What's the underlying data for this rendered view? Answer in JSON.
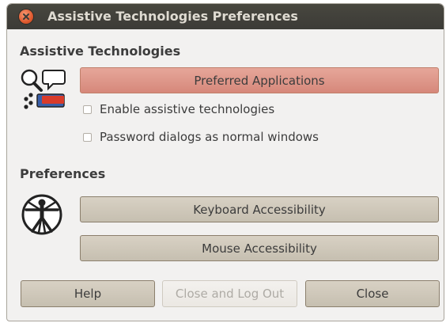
{
  "window": {
    "title": "Assistive Technologies Preferences",
    "close_icon": "close-icon"
  },
  "assistive": {
    "heading": "Assistive Technologies",
    "icon": "assistive-technologies-icon",
    "preferred_apps_label": "Preferred Applications",
    "enable_label": "Enable assistive technologies",
    "enable_checked": false,
    "password_label": "Password dialogs as normal windows",
    "password_checked": false
  },
  "preferences": {
    "heading": "Preferences",
    "icon": "vitruvian-man-icon",
    "keyboard_label": "Keyboard Accessibility",
    "mouse_label": "Mouse Accessibility"
  },
  "footer": {
    "help_label": "Help",
    "logout_label": "Close and Log Out",
    "close_label": "Close"
  },
  "colors": {
    "titlebar": "#3c3b37",
    "accent": "#e05a2f",
    "window_bg": "#f2f1f0"
  }
}
